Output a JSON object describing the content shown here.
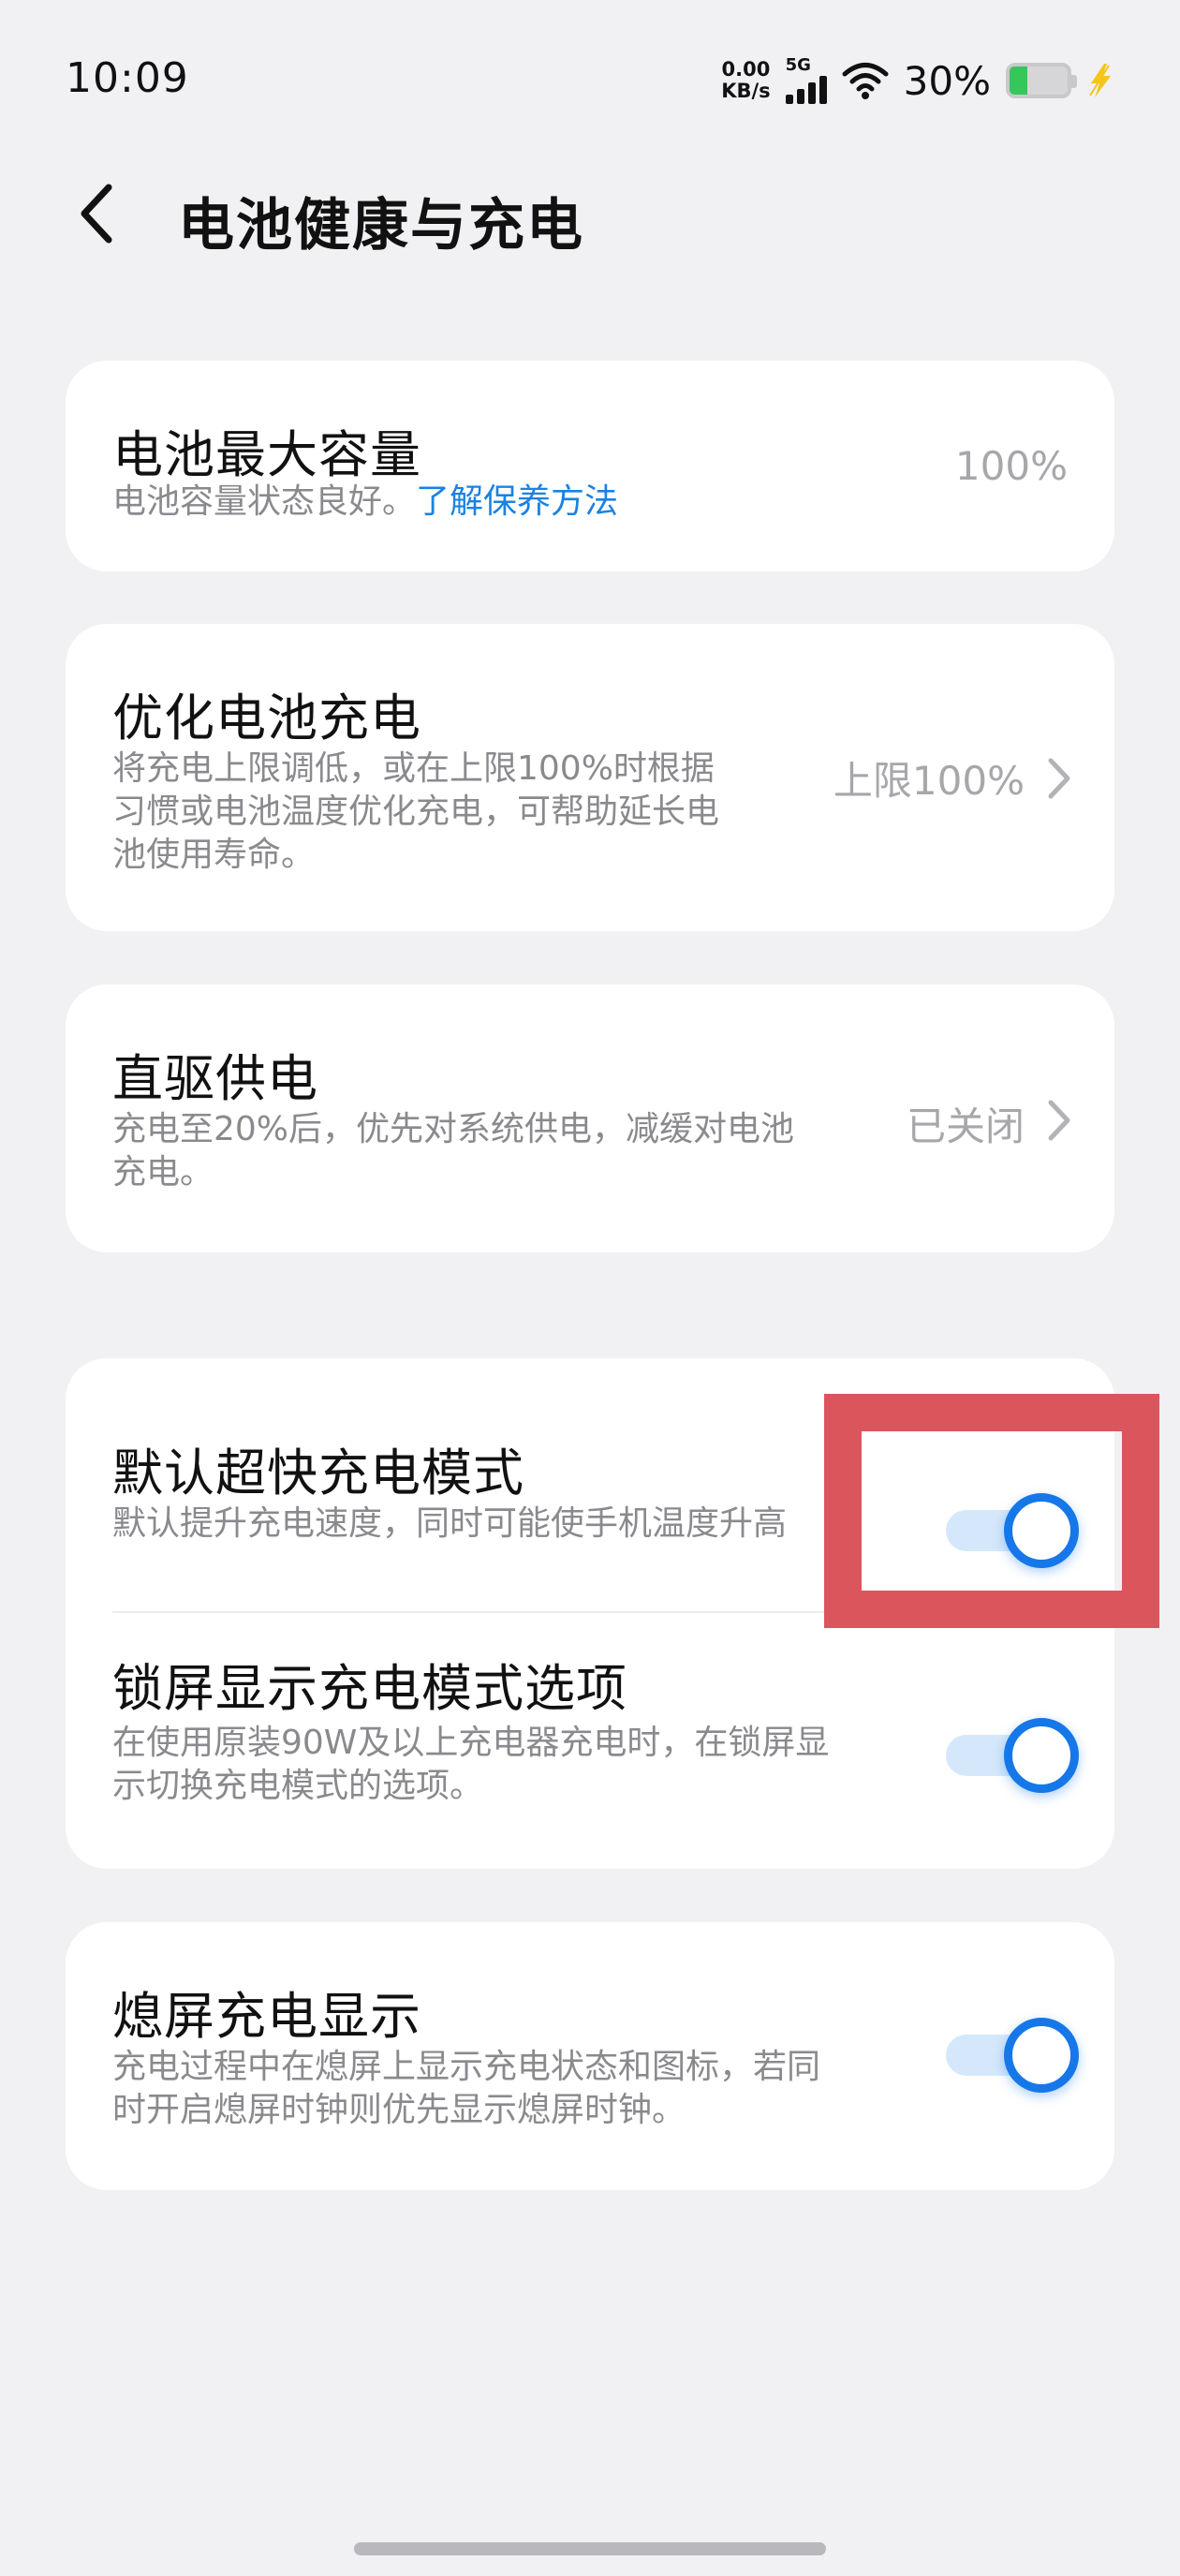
{
  "status_bar": {
    "time": "10:09",
    "net_speed_value": "0.00",
    "net_speed_unit": "KB/s",
    "network_type": "5G",
    "battery_percent": "30%",
    "battery_level": 0.3,
    "icons": [
      "wifi-icon",
      "signal-icon",
      "battery-icon",
      "charging-bolt-icon"
    ]
  },
  "header": {
    "title": "电池健康与充电",
    "back_icon": "chevron-left-icon"
  },
  "sections": {
    "max_capacity": {
      "title": "电池最大容量",
      "desc": "电池容量状态良好。",
      "link": "了解保养方法",
      "value": "100%"
    },
    "optimized_charging": {
      "title": "优化电池充电",
      "desc_lines": [
        "将充电上限调低，或在上限100%时根据",
        "习惯或电池温度优化充电，可帮助延长电",
        "池使用寿命。"
      ],
      "value": "上限100%"
    },
    "bypass_power": {
      "title": "直驱供电",
      "desc_lines": [
        "充电至20%后，优先对系统供电，减缓对电池",
        "充电。"
      ],
      "value": "已关闭"
    },
    "super_fast_mode": {
      "title": "默认超快充电模式",
      "desc": "默认提升充电速度，同时可能使手机温度升高",
      "enabled": true
    },
    "lockscreen_mode_option": {
      "title": "锁屏显示充电模式选项",
      "desc_lines": [
        "在使用原装90W及以上充电器充电时，在锁屏显",
        "示切换充电模式的选项。"
      ],
      "enabled": true
    },
    "aod_charging": {
      "title": "熄屏充电显示",
      "desc_lines": [
        "充电过程中在熄屏上显示充电状态和图标，若同",
        "时开启熄屏时钟则优先显示熄屏时钟。"
      ],
      "enabled": true
    }
  },
  "colors": {
    "accent": "#1677e8",
    "link": "#1b82e0",
    "highlight": "#db555c",
    "background": "#f1f1f4"
  }
}
